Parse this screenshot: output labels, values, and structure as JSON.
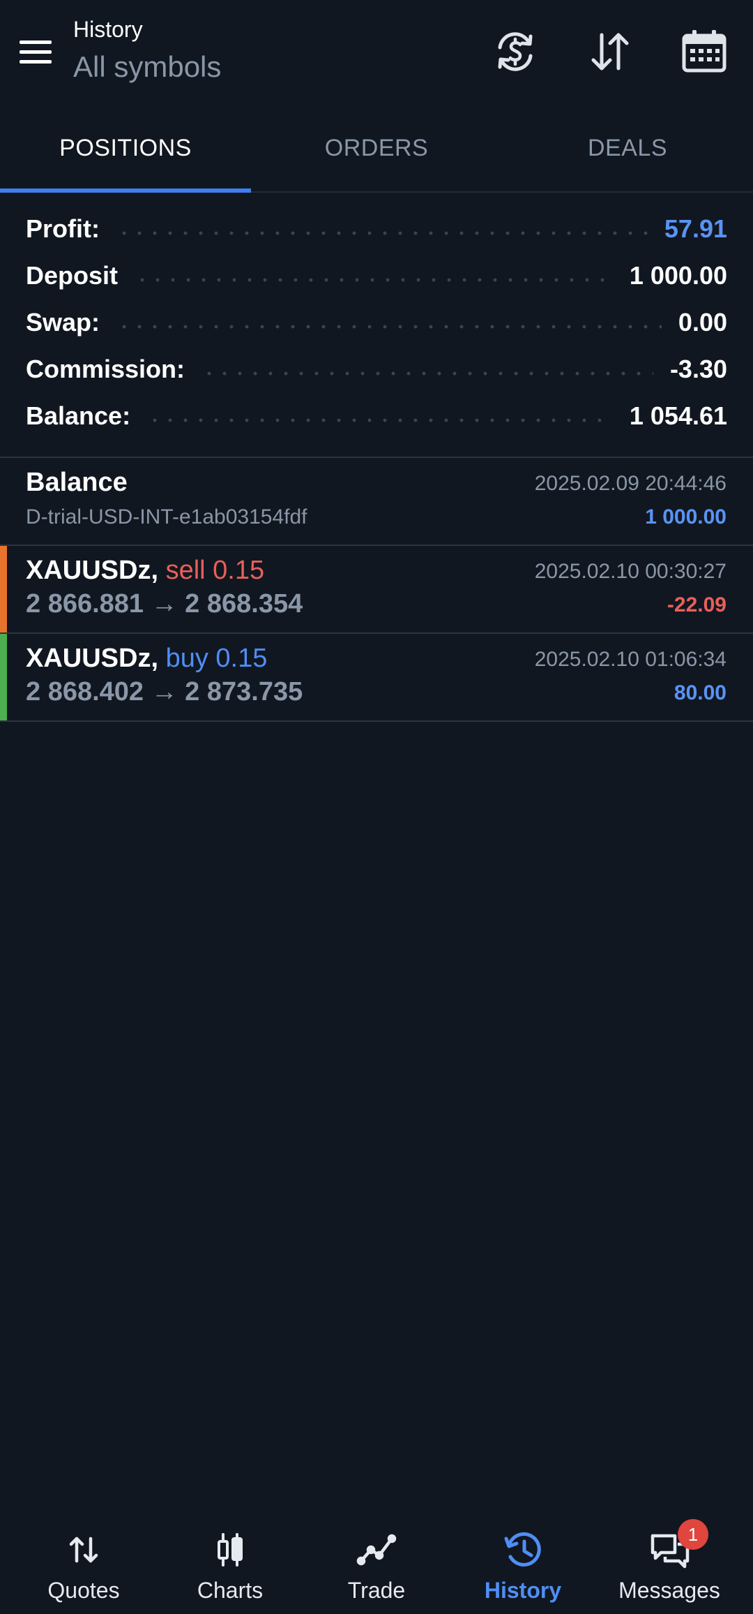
{
  "header": {
    "title": "History",
    "subtitle": "All symbols"
  },
  "icons": {
    "menu": "hamburger-menu-icon",
    "exchange": "currency-exchange-icon",
    "sort": "sort-arrows-icon",
    "calendar": "calendar-icon"
  },
  "tabs": [
    {
      "label": "POSITIONS",
      "active": true
    },
    {
      "label": "ORDERS",
      "active": false
    },
    {
      "label": "DEALS",
      "active": false
    }
  ],
  "summary": {
    "profit": {
      "label": "Profit:",
      "value": "57.91"
    },
    "deposit": {
      "label": "Deposit",
      "value": "1 000.00"
    },
    "swap": {
      "label": "Swap:",
      "value": "0.00"
    },
    "commission": {
      "label": "Commission:",
      "value": "-3.30"
    },
    "balance": {
      "label": "Balance:",
      "value": "1 054.61"
    }
  },
  "deals": [
    {
      "title": "Balance",
      "subtitle": "D-trial-USD-INT-e1ab03154fdf",
      "time": "2025.02.09 20:44:46",
      "amount": "1 000.00"
    },
    {
      "symbol": "XAUUSDz,",
      "side": "sell 0.15",
      "prices": "2 866.881 → 2 868.354",
      "time": "2025.02.10 00:30:27",
      "amount": "-22.09"
    },
    {
      "symbol": "XAUUSDz,",
      "side": "buy 0.15",
      "prices": "2 868.402 → 2 873.735",
      "time": "2025.02.10 01:06:34",
      "amount": "80.00"
    }
  ],
  "nav": [
    {
      "label": "Quotes",
      "icon": "quotes-arrows-icon"
    },
    {
      "label": "Charts",
      "icon": "candlestick-chart-icon"
    },
    {
      "label": "Trade",
      "icon": "trade-line-chart-icon"
    },
    {
      "label": "History",
      "icon": "history-clock-icon",
      "active": true
    },
    {
      "label": "Messages",
      "icon": "chat-bubbles-icon",
      "badge": "1"
    }
  ],
  "colors": {
    "background": "#111720",
    "accent": "#3e7ef0",
    "positive": "#5a93f5",
    "negative": "#e8605a",
    "sell_bar": "#e8732c",
    "buy_bar": "#4caf50"
  }
}
